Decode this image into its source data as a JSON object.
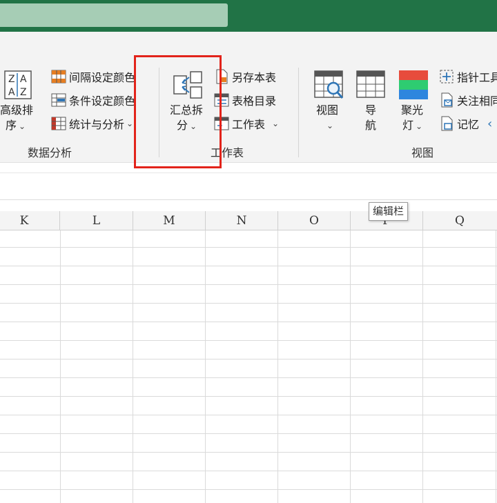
{
  "colors": {
    "titlebar": "#217346",
    "highlight": "#e2231a",
    "icon_blue": "#2e75b6",
    "icon_red": "#c0392b"
  },
  "ribbon": {
    "data_analysis": {
      "advanced_sort_line1": "高级排",
      "advanced_sort_line2": "序",
      "interval_color": "间隔设定颜色",
      "condition_color": "条件设定颜色",
      "stats_analysis": "统计与分析",
      "group_label": "数据分析"
    },
    "worksheet": {
      "summary_split_line1": "汇总拆",
      "summary_split_line2": "分",
      "save_copy": "另存本表",
      "table_of_contents": "表格目录",
      "worksheet_menu": "工作表",
      "group_label": "工作表"
    },
    "view": {
      "view_button": "视图",
      "navigate_line1": "导",
      "navigate_line2": "航",
      "spotlight_line1": "聚光",
      "spotlight_line2": "灯",
      "pointer_tool": "指针工具",
      "watch_related": "关注相同",
      "memory": "记忆",
      "group_label": "视图"
    }
  },
  "columns": [
    "K",
    "L",
    "M",
    "N",
    "O",
    "P",
    "Q"
  ],
  "tooltip": "编辑栏"
}
